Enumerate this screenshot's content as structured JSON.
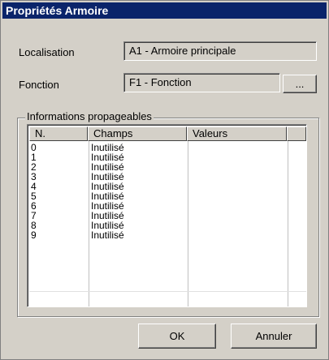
{
  "window": {
    "title": "Propriétés Armoire"
  },
  "localisation": {
    "label": "Localisation",
    "value": "A1 - Armoire principale"
  },
  "fonction": {
    "label": "Fonction",
    "value": "F1 - Fonction",
    "browse_label": "..."
  },
  "group": {
    "title": "Informations propageables"
  },
  "table": {
    "headers": [
      "N.",
      "Champs",
      "Valeurs"
    ],
    "rows": [
      {
        "n": "0",
        "champ": "Inutilisé",
        "valeur": ""
      },
      {
        "n": "1",
        "champ": "Inutilisé",
        "valeur": ""
      },
      {
        "n": "2",
        "champ": "Inutilisé",
        "valeur": ""
      },
      {
        "n": "3",
        "champ": "Inutilisé",
        "valeur": ""
      },
      {
        "n": "4",
        "champ": "Inutilisé",
        "valeur": ""
      },
      {
        "n": "5",
        "champ": "Inutilisé",
        "valeur": ""
      },
      {
        "n": "6",
        "champ": "Inutilisé",
        "valeur": ""
      },
      {
        "n": "7",
        "champ": "Inutilisé",
        "valeur": ""
      },
      {
        "n": "8",
        "champ": "Inutilisé",
        "valeur": ""
      },
      {
        "n": "9",
        "champ": "Inutilisé",
        "valeur": ""
      }
    ]
  },
  "buttons": {
    "ok_label": "OK",
    "cancel_label": "Annuler"
  },
  "colors": {
    "titlebar": "#0a246a",
    "face": "#d4d0c8"
  }
}
